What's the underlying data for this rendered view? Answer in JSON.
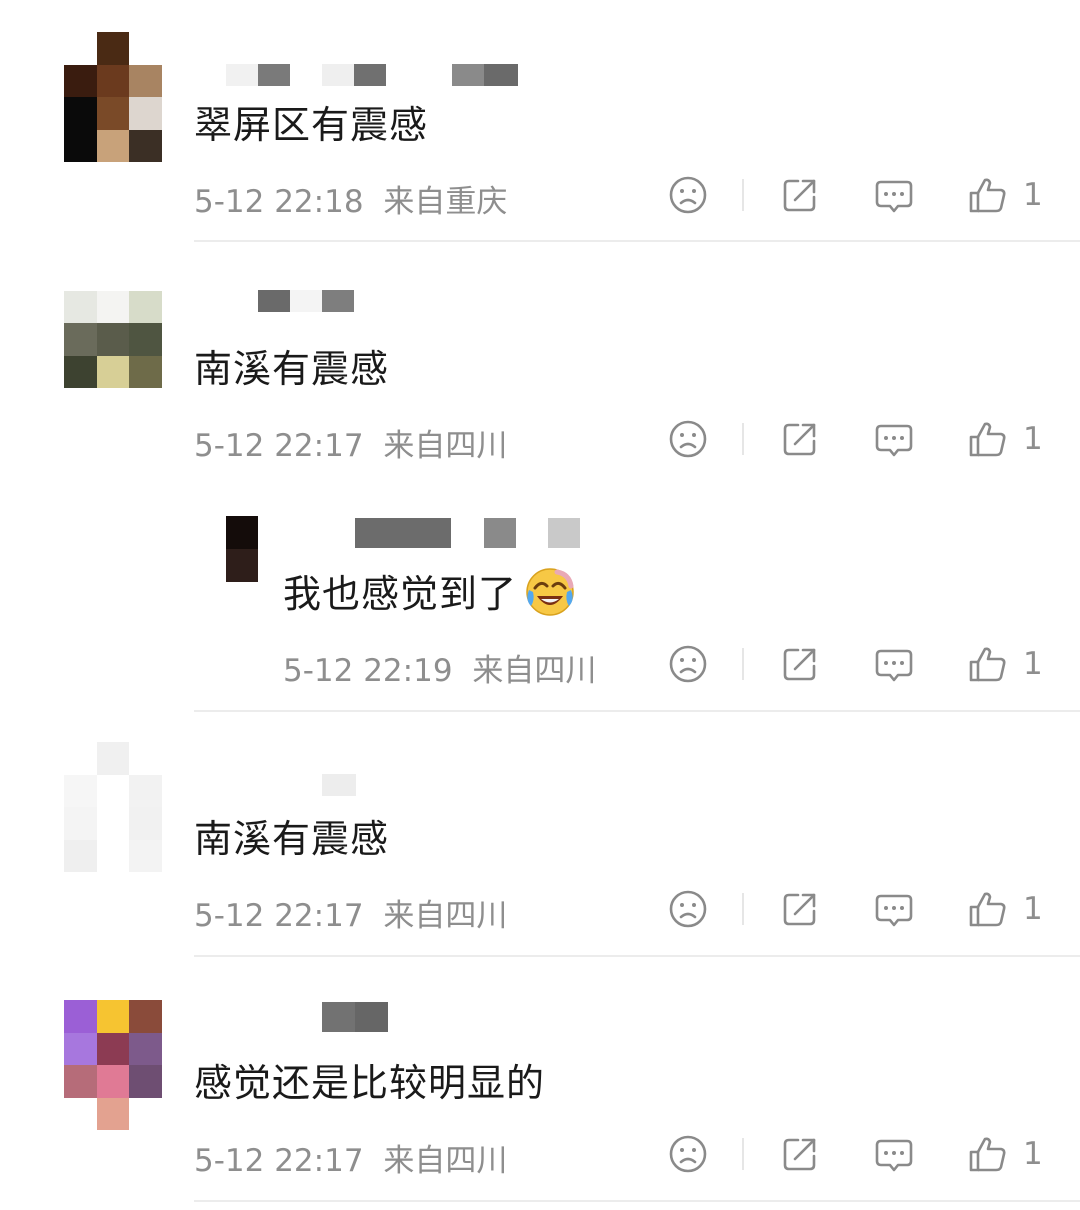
{
  "comments": [
    {
      "text": "翠屏区有震感",
      "time": "5-12 22:18",
      "location": "来自重庆",
      "likes": "1",
      "avatar_colors": [
        "#ffffff",
        "#4a2a14",
        "#ffffff",
        "#3a1c0f",
        "#6b3a1e",
        "#a88462",
        "#0a0a0a",
        "#7a4a28",
        "#ddd6cf",
        "#0a0a0a",
        "#c8a27a",
        "#3b2f25"
      ]
    },
    {
      "text": "南溪有震感",
      "time": "5-12 22:17",
      "location": "来自四川",
      "likes": "1",
      "avatar_colors": [
        "#ffffff",
        "#ffffff",
        "#ffffff",
        "#e6e8e2",
        "#f4f4f2",
        "#d7dcc9",
        "#6a6b5b",
        "#5a5c4b",
        "#4f5541",
        "#3d4230",
        "#d7cf96",
        "#6e6b49"
      ]
    },
    {
      "text": "我也感觉到了",
      "time": "5-12 22:19",
      "location": "来自四川",
      "likes": "1"
    },
    {
      "text": "南溪有震感",
      "time": "5-12 22:17",
      "location": "来自四川",
      "likes": "1",
      "avatar_colors": [
        "#ffffff",
        "#f0f0f0",
        "#ffffff",
        "#f6f6f6",
        "#ffffff",
        "#f2f2f2",
        "#f4f4f4",
        "#ffffff",
        "#f1f1f1",
        "#efefef",
        "#ffffff",
        "#f3f3f3"
      ]
    },
    {
      "text": "感觉还是比较明显的",
      "time": "5-12 22:17",
      "location": "来自四川",
      "likes": "1",
      "avatar_colors": [
        "#9b5fd6",
        "#f6c431",
        "#8a4b3a",
        "#a777de",
        "#8c3b53",
        "#7d5a8b",
        "#b66c79",
        "#e07a95",
        "#6e4e72",
        "#ffffff",
        "#e3a290",
        "#ffffff"
      ]
    }
  ],
  "icons": {
    "dislike": "sad-face-icon",
    "share": "share-icon",
    "reply": "comment-icon",
    "like": "thumbs-up-icon",
    "emoji": "laugh-cry-emoji"
  },
  "colors": {
    "text": "#1a1a1a",
    "meta": "#8e8e8e",
    "icon": "#8a8a8a",
    "divider": "#ececec"
  }
}
